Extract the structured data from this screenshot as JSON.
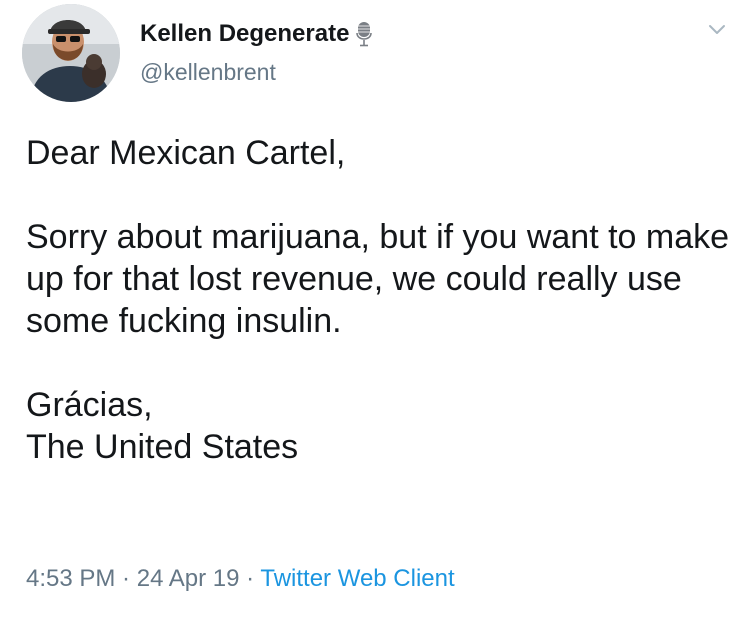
{
  "tweet": {
    "author": {
      "display_name": "Kellen Degenerate",
      "handle": "@kellenbrent",
      "badge_icon": "microphone-icon",
      "avatar": "avatar-photo"
    },
    "menu_icon": "chevron-down-icon",
    "text": {
      "line1": "Dear Mexican Cartel,",
      "line2": "Sorry about marijuana, but if you want to make up for that lost revenue, we could really use some fucking insulin.",
      "line3": "Grácias,",
      "line4": "The United States"
    },
    "meta": {
      "time": "4:53 PM",
      "separator1": " · ",
      "date": "24 Apr 19",
      "separator2": " · ",
      "client": "Twitter Web Client"
    },
    "colors": {
      "text": "#14171a",
      "secondary": "#657786",
      "link": "#1b95e0"
    }
  }
}
